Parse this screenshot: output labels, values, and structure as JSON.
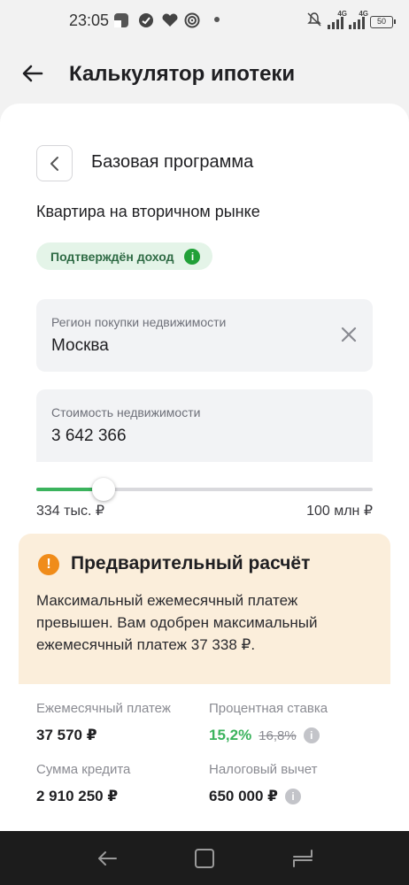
{
  "status_bar": {
    "time": "23:05",
    "battery": "50",
    "network": "4G",
    "icons": [
      "app-icon",
      "sber-icon",
      "heart-icon",
      "spiral-icon",
      "mute-icon",
      "signal-icon",
      "battery-icon"
    ]
  },
  "app_bar": {
    "title": "Калькулятор ипотеки"
  },
  "program": {
    "title": "Базовая программа",
    "subtitle": "Квартира на вторичном рынке",
    "chip_label": "Подтверждён доход"
  },
  "region": {
    "label": "Регион покупки недвижимости",
    "value": "Москва"
  },
  "cost": {
    "label": "Стоимость недвижимости",
    "value": "3 642 366",
    "slider_fraction": 0.199,
    "min_label": "334 тыс. ₽",
    "max_label": "100 млн ₽"
  },
  "warning": {
    "title": "Предварительный расчёт",
    "text": "Максимальный ежемесячный платеж превышен. Вам одобрен максимальный ежемесячный платеж 37 338 ₽."
  },
  "results": {
    "monthly_label": "Ежемесячный платеж",
    "monthly_value": "37 570 ₽",
    "rate_label": "Процентная ставка",
    "rate_value": "15,2%",
    "rate_old": "16,8%",
    "credit_label": "Сумма кредита",
    "credit_value": "2 910 250 ₽",
    "tax_label": "Налоговый вычет",
    "tax_value": "650 000 ₽"
  },
  "colors": {
    "accent_green": "#21a038",
    "slider_green": "#3bb35d",
    "warning_bg": "#fbeedb",
    "warning_icon": "#f08c1a"
  }
}
